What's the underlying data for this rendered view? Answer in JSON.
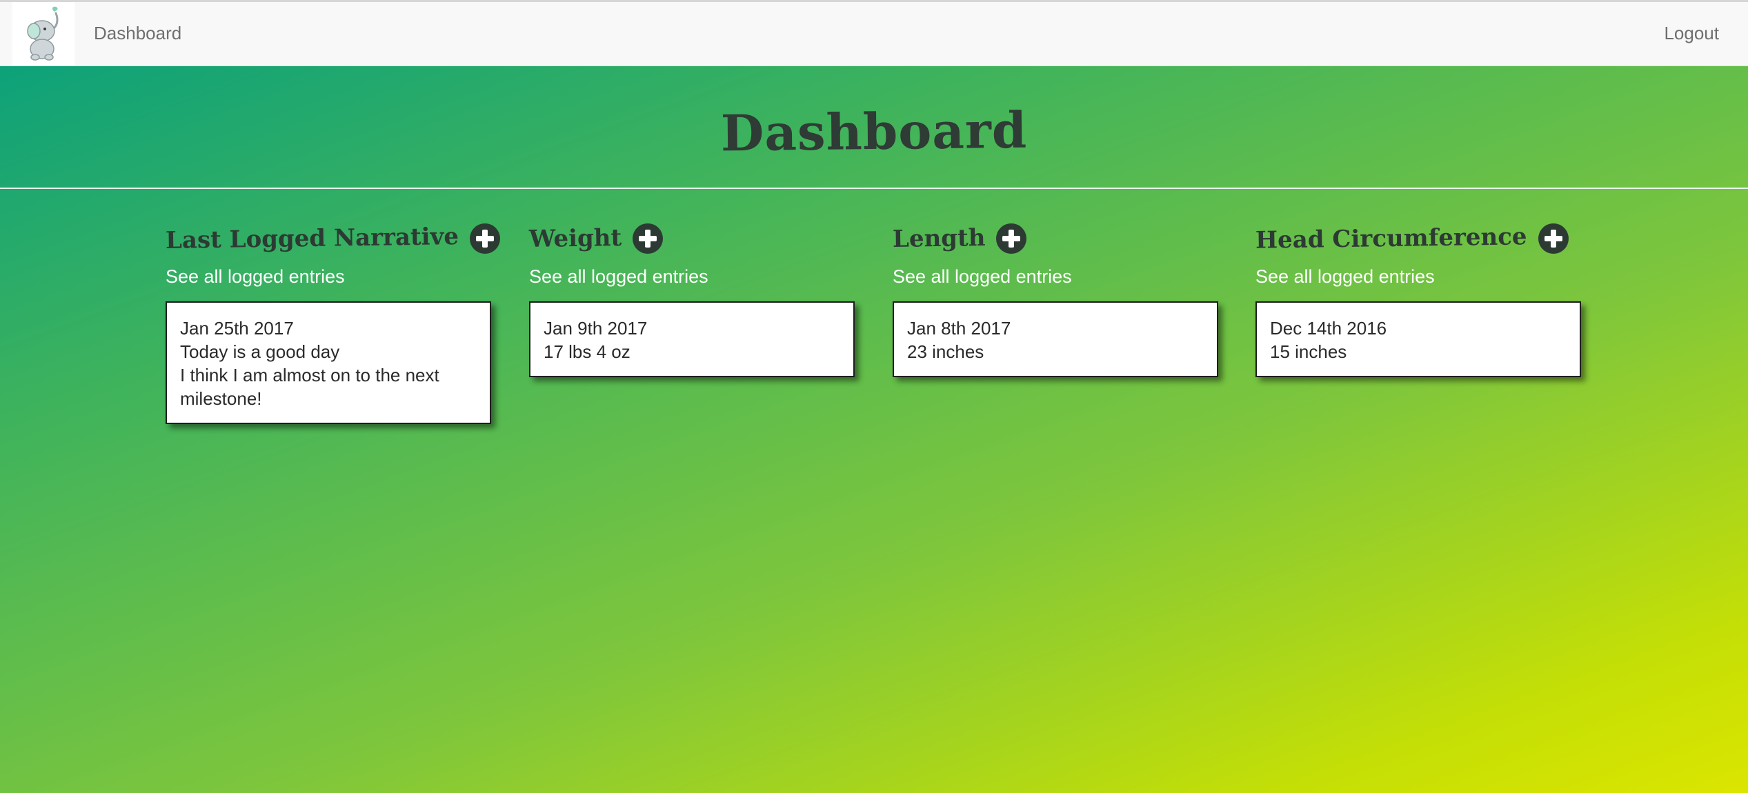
{
  "nav": {
    "logo_icon": "elephant-logo-icon",
    "dashboard_label": "Dashboard",
    "logout_label": "Logout"
  },
  "page": {
    "title": "Dashboard"
  },
  "columns": [
    {
      "title": "Last Logged Narrative",
      "add_icon": "plus-circle-icon",
      "see_all": "See all logged entries",
      "entry": {
        "date": "Jan 25th 2017",
        "line1": "Today is a good day",
        "line2": "I think I am almost on to the next milestone!"
      }
    },
    {
      "title": "Weight",
      "add_icon": "plus-circle-icon",
      "see_all": "See all logged entries",
      "entry": {
        "date": "Jan 9th 2017",
        "line1": "17 lbs 4 oz"
      }
    },
    {
      "title": "Length",
      "add_icon": "plus-circle-icon",
      "see_all": "See all logged entries",
      "entry": {
        "date": "Jan 8th 2017",
        "line1": "23 inches"
      }
    },
    {
      "title": "Head Circumference",
      "add_icon": "plus-circle-icon",
      "see_all": "See all logged entries",
      "entry": {
        "date": "Dec 14th 2016",
        "line1": "15 inches"
      }
    }
  ],
  "colors": {
    "gradient_start": "#049e7f",
    "gradient_end": "#dbe500",
    "heading_dark": "#2c3a33",
    "navbar_bg": "#f8f8f8"
  }
}
